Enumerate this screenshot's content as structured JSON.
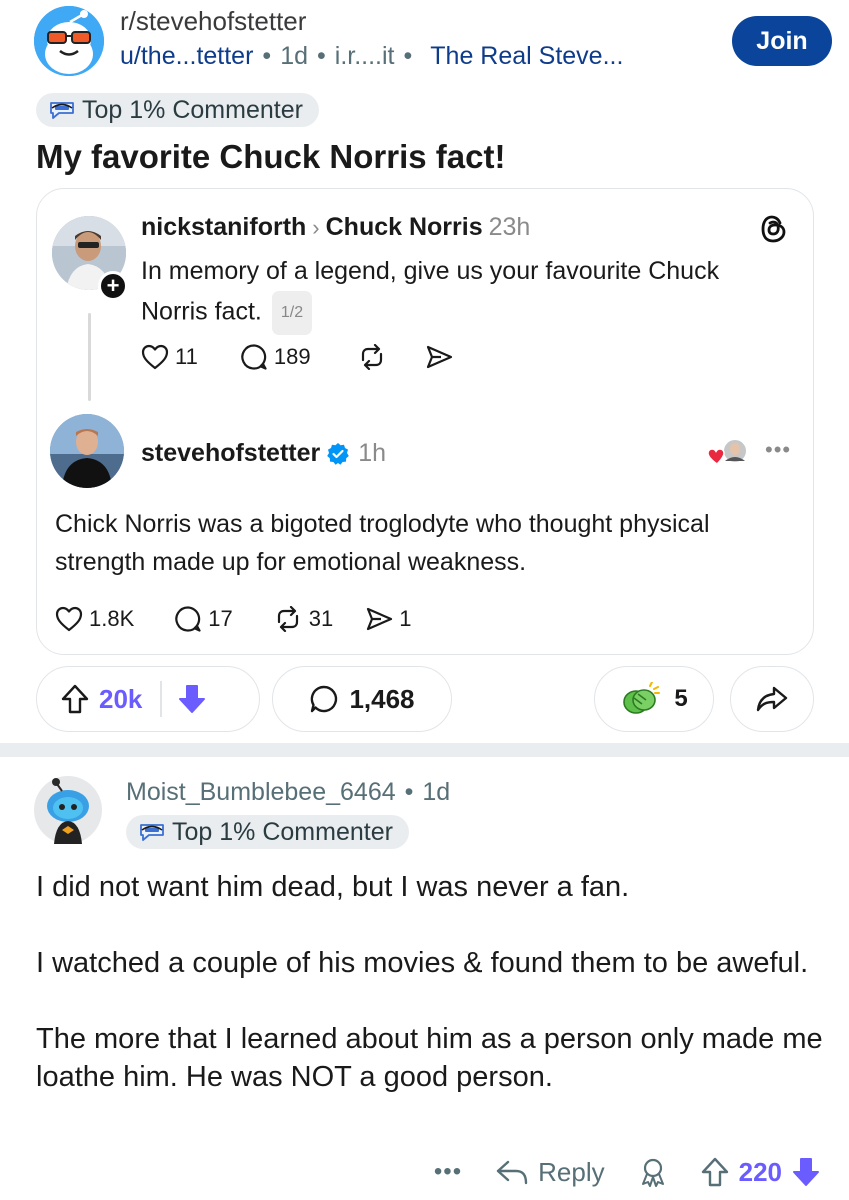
{
  "post": {
    "subreddit": "r/stevehofstetter",
    "author": "u/the...tetter",
    "age": "1d",
    "domain": "i.r....it",
    "user_flair": "The Real Steve...",
    "join_label": "Join",
    "author_badge": "Top 1% Commenter",
    "title": "My favorite Chuck Norris fact!"
  },
  "embed": {
    "original": {
      "username": "nickstaniforth",
      "reply_to": "Chuck Norris",
      "age": "23h",
      "text": "In memory of a legend, give us your favourite Chuck Norris fact.",
      "pager": "1/2",
      "likes": "11",
      "replies": "189"
    },
    "reply": {
      "username": "stevehofstetter",
      "age": "1h",
      "text": "Chick Norris was a bigoted troglodyte who thought physical strength made up for emotional weakness.",
      "likes": "1.8K",
      "replies": "17",
      "reposts": "31",
      "shares": "1"
    }
  },
  "post_actions": {
    "score": "20k",
    "comments": "1,468",
    "awards": "5"
  },
  "comment": {
    "username": "Moist_Bumblebee_6464",
    "age": "1d",
    "badge": "Top 1% Commenter",
    "paragraphs": [
      "I did not want him dead, but I was never a fan.",
      "I watched a couple of his movies & found them to be aweful.",
      "The more that I learned about him as a person only made me loathe him. He was NOT a good person."
    ],
    "more_label": "•••",
    "reply_label": "Reply",
    "score": "220"
  },
  "icons": {
    "verified": "verified-badge-icon",
    "threads": "threads-logo-icon",
    "upvote": "upvote-arrow-icon",
    "downvote": "downvote-arrow-icon"
  },
  "colors": {
    "join_button": "#0a449b",
    "vote_accent": "#6a5cff",
    "link_text": "#0e3c8a",
    "verified": "#0095f6"
  }
}
